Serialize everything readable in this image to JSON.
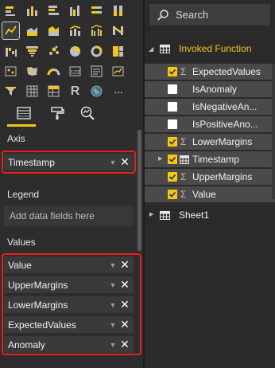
{
  "visualizations": {
    "icons": [
      [
        "stacked-bar-icon",
        "stacked-column-icon",
        "clustered-bar-icon",
        "clustered-column-icon",
        "100-bar-icon",
        "100-column-icon"
      ],
      [
        "line-chart-icon",
        "area-chart-icon",
        "stacked-area-icon",
        "line-column-icon",
        "line-clustered-column-icon",
        "ribbon-chart-icon"
      ],
      [
        "waterfall-icon",
        "funnel-icon",
        "scatter-icon",
        "pie-icon",
        "donut-icon",
        "treemap-icon"
      ],
      [
        "map-icon",
        "filled-map-icon",
        "gauge-icon",
        "card-icon",
        "multirow-card-icon",
        "kpi-icon"
      ],
      [
        "slicer-icon",
        "table-icon",
        "matrix-icon",
        "r-visual-icon",
        "globe-icon",
        "more-icon"
      ]
    ],
    "selected": "line-chart-icon",
    "r_label": "R",
    "more_label": "···"
  },
  "tabs": [
    "fields-tab",
    "format-tab",
    "analytics-tab"
  ],
  "wells": {
    "axis": {
      "title": "Axis",
      "items": [
        "Timestamp"
      ]
    },
    "legend": {
      "title": "Legend",
      "placeholder": "Add data fields here"
    },
    "values": {
      "title": "Values",
      "items": [
        "Value",
        "UpperMargins",
        "LowerMargins",
        "ExpectedValues",
        "Anomaly"
      ]
    }
  },
  "search": {
    "placeholder": "Search"
  },
  "fields": {
    "table1": {
      "name": "Invoked Function",
      "items": [
        {
          "label": "ExpectedValues",
          "checked": true,
          "sigma": true
        },
        {
          "label": "IsAnomaly",
          "checked": false,
          "sigma": false
        },
        {
          "label": "IsNegativeAn...",
          "checked": false,
          "sigma": false
        },
        {
          "label": "IsPositiveAno...",
          "checked": false,
          "sigma": false
        },
        {
          "label": "LowerMargins",
          "checked": true,
          "sigma": true
        },
        {
          "label": "Timestamp",
          "checked": true,
          "sigma": false
        },
        {
          "label": "UpperMargins",
          "checked": true,
          "sigma": true
        },
        {
          "label": "Value",
          "checked": true,
          "sigma": true
        }
      ]
    },
    "table2": {
      "name": "Sheet1"
    }
  },
  "colors": {
    "accent": "#f2c811",
    "highlight_box": "#e8201e",
    "panel": "#2d2d2d"
  }
}
